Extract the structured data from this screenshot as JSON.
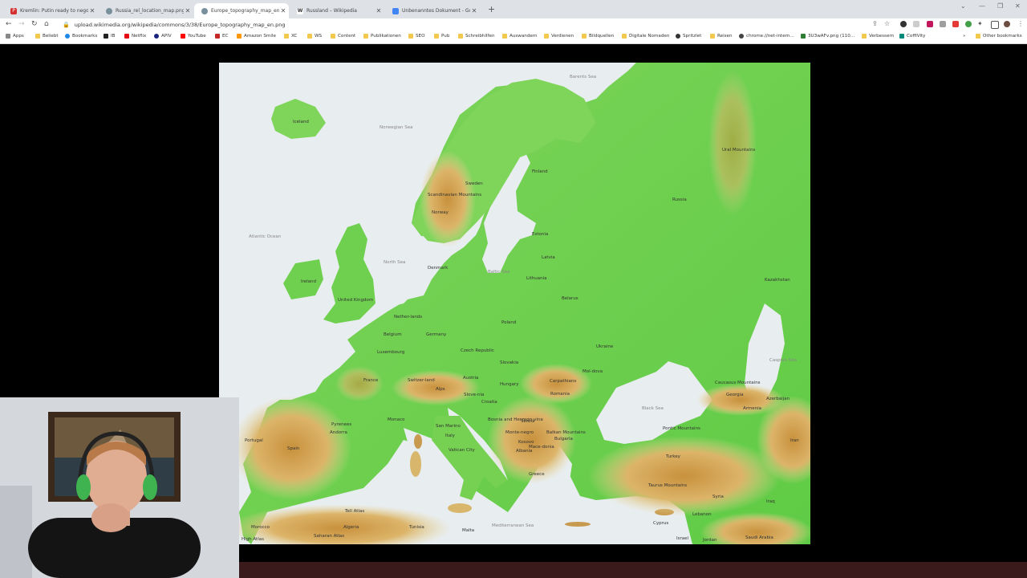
{
  "tabs": [
    {
      "title": "Kremlin: Putin ready to negotiat",
      "icon": "pinterest-icon",
      "color": "#d32f2f"
    },
    {
      "title": "Russia_rel_location_map.png (23",
      "icon": "wikimedia-icon",
      "color": "#607d8b"
    },
    {
      "title": "Europe_topography_map_en.png",
      "icon": "wikimedia-icon",
      "color": "#607d8b",
      "active": true
    },
    {
      "title": "Russland – Wikipedia",
      "icon": "wikipedia-icon",
      "color": "#555555"
    },
    {
      "title": "Unbenanntes Dokument - Goog",
      "icon": "docs-icon",
      "color": "#4285f4"
    }
  ],
  "newtab": "+",
  "window": {
    "minimize": "—",
    "maximize": "❐",
    "close": "✕"
  },
  "address": {
    "url": "upload.wikimedia.org/wikipedia/commons/3/38/Europe_topography_map_en.png"
  },
  "bookmarks": [
    {
      "label": "Apps"
    },
    {
      "label": "Beliebt"
    },
    {
      "label": "Bookmarks"
    },
    {
      "label": "IB"
    },
    {
      "label": "Netflix"
    },
    {
      "label": "APIV"
    },
    {
      "label": "YouTube"
    },
    {
      "label": "EC"
    },
    {
      "label": "Amazon Smile"
    },
    {
      "label": "XC"
    },
    {
      "label": "WS"
    },
    {
      "label": "Content"
    },
    {
      "label": "Publikationen"
    },
    {
      "label": "SEO"
    },
    {
      "label": "Pub"
    },
    {
      "label": "Schreibhilfen"
    },
    {
      "label": "Auswandern"
    },
    {
      "label": "Verdienen"
    },
    {
      "label": "Bildquellen"
    },
    {
      "label": "Digitale Nomaden"
    },
    {
      "label": "Spritzlet"
    },
    {
      "label": "Reisen"
    },
    {
      "label": "chrome://net-intern..."
    },
    {
      "label": "3U3wAFv.png (110..."
    },
    {
      "label": "Verbessern"
    },
    {
      "label": "CoffiVity"
    }
  ],
  "other_bookmarks": "Other bookmarks",
  "map_labels": {
    "barents_sea": "Barents Sea",
    "iceland": "Iceland",
    "norwegian_sea": "Norwegian Sea",
    "finland": "Finland",
    "sweden": "Sweden",
    "scandinavian_mountains": "Scandinavian Mountains",
    "norway": "Norway",
    "ural_mountains": "Ural Mountains",
    "russia": "Russia",
    "atlantic_ocean": "Atlantic Ocean",
    "estonia": "Estonia",
    "latvia": "Latvia",
    "north_sea": "North Sea",
    "denmark": "Denmark",
    "baltic_sea": "Baltic Sea",
    "lithuania": "Lithuania",
    "kazakhstan": "Kazakhstan",
    "ireland": "Ireland",
    "united_kingdom": "United Kingdom",
    "belarus": "Belarus",
    "netherlands": "Nether-lands",
    "poland": "Poland",
    "belgium": "Belgium",
    "germany": "Germany",
    "luxembourg": "Luxembourg",
    "czech_republic": "Czech Republic",
    "ukraine": "Ukraine",
    "caspian_sea": "Caspian Sea",
    "slovakia": "Slovakia",
    "moldova": "Mol-dova",
    "carpathians": "Carpathians",
    "france": "France",
    "switzerland": "Switzer-land",
    "austria": "Austria",
    "hungary": "Hungary",
    "caucasus_mountains": "Caucasus Mountains",
    "romania": "Romania",
    "alps": "Alps",
    "slovenia": "Slove-nia",
    "georgia": "Georgia",
    "azerbaijan": "Azerbaijan",
    "croatia": "Croatia",
    "black_sea": "Black Sea",
    "armenia": "Armenia",
    "pyrenees": "Pyrenees",
    "monaco": "Monaco",
    "andorra": "Andorra",
    "bosnia": "Bosnia and Herzego-vina",
    "serbia": "Serbia",
    "san_marino": "San Marino",
    "portugal": "Portugal",
    "spain": "Spain",
    "italy": "Italy",
    "montenegro": "Monte-negro",
    "balkan_mountains": "Balkan Mountains",
    "bulgaria": "Bulgaria",
    "pontic_mountains": "Pontic Mountains",
    "vatican_city": "Vatican City",
    "kosovo": "Kosovo",
    "iran": "Iran",
    "albania": "Albania",
    "macedonia": "Mace-donia",
    "turkey": "Turkey",
    "greece": "Greece",
    "taurus_mountains": "Taurus Mountains",
    "syria": "Syria",
    "iraq": "Iraq",
    "tell_atlas": "Tell Atlas",
    "lebanon": "Lebanon",
    "morocco": "Morocco",
    "algeria": "Algeria",
    "tunisia": "Tunisia",
    "cyprus": "Cyprus",
    "malta": "Malta",
    "mediterranean_sea": "Mediterranean Sea",
    "israel": "Israel",
    "jordan": "Jordan",
    "saudi_arabia": "Saudi Arabia",
    "saharan_atlas": "Saharan Atlas",
    "high_atlas": "High Atlas"
  }
}
